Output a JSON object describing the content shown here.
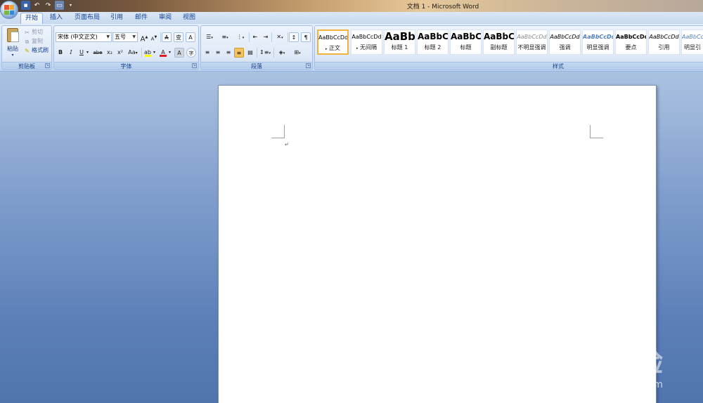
{
  "window": {
    "title": "文档 1 - Microsoft Word"
  },
  "qat": {
    "icons": [
      "save-icon",
      "undo-icon",
      "redo-icon",
      "print-icon",
      "customize-icon"
    ]
  },
  "tabs": [
    {
      "label": "开始",
      "active": true
    },
    {
      "label": "插入"
    },
    {
      "label": "页面布局"
    },
    {
      "label": "引用"
    },
    {
      "label": "邮件"
    },
    {
      "label": "审阅"
    },
    {
      "label": "视图"
    }
  ],
  "clipboard": {
    "paste": "粘贴",
    "cut": "剪切",
    "copy": "复制",
    "format_painter": "格式刷",
    "label": "剪贴板"
  },
  "font": {
    "name": "宋体 (中文正文)",
    "size": "五号",
    "label": "字体",
    "bold": "B",
    "italic": "I",
    "underline": "U",
    "strike": "abe",
    "subscript": "x₂",
    "superscript": "x²",
    "change_case": "Aa",
    "grow": "A",
    "shrink": "A",
    "clear": "A",
    "pinyin": "变",
    "char_border": "A",
    "enclose": "字",
    "font_color_hex": "#e02020",
    "highlight_hex": "#ffff00"
  },
  "paragraph": {
    "label": "段落"
  },
  "styles": {
    "label": "样式",
    "items": [
      {
        "sample": "AaBbCcDd",
        "name": "正文"
      },
      {
        "sample": "AaBbCcDd",
        "name": "无间隔"
      },
      {
        "sample": "AaBb",
        "name": "标题 1"
      },
      {
        "sample": "AaBbC",
        "name": "标题 2"
      },
      {
        "sample": "AaBbC",
        "name": "标题"
      },
      {
        "sample": "AaBbC",
        "name": "副标题"
      },
      {
        "sample": "AaBbCcDd",
        "name": "不明显强调"
      },
      {
        "sample": "AaBbCcDd",
        "name": "强调"
      },
      {
        "sample": "AaBbCcDd",
        "name": "明显强调"
      },
      {
        "sample": "AaBbCcDd",
        "name": "要点"
      },
      {
        "sample": "AaBbCcDd",
        "name": "引用"
      },
      {
        "sample": "AaBbCcDd",
        "name": "明显引"
      }
    ]
  },
  "document": {
    "paragraph_mark": "↵"
  },
  "watermark": {
    "logo": "Bai du 经验",
    "url": "jingyan.baidu.com"
  }
}
